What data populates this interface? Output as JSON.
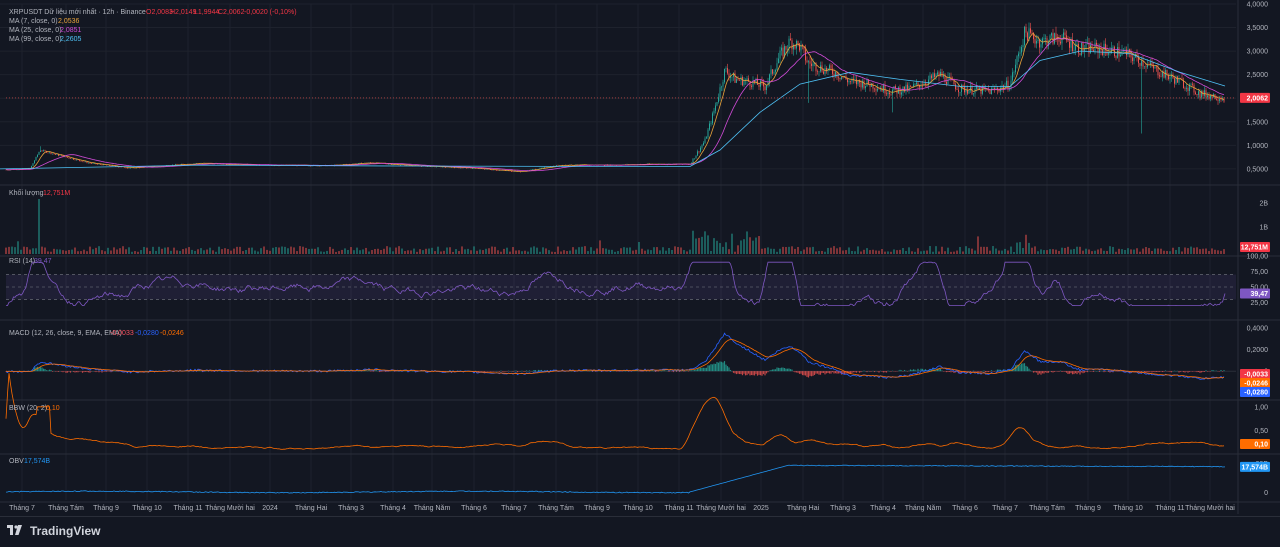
{
  "chart_data": [
    {
      "type": "candlestick",
      "title": "XRPUSDT Dữ liệu mới nhất · 12h · Binance",
      "ohlc": {
        "o": "O2,0083",
        "h": "H2,0149",
        "l": "L1,9944",
        "c": "C2,0062",
        "change": "-0,0020 (-0,10%)"
      },
      "ma": [
        {
          "name": "MA (7, close, 0)",
          "value": "2,0536",
          "color": "#e8a33b"
        },
        {
          "name": "MA (25, close, 0)",
          "value": "2,0851",
          "color": "#d14bd8"
        },
        {
          "name": "MA (99, close, 0)",
          "value": "2,2605",
          "color": "#4fc3f7"
        }
      ],
      "price_ticks": [
        "4,0000",
        "3,5000",
        "3,0000",
        "2,5000",
        "2,0000",
        "1,5000",
        "1,0000",
        "0,5000"
      ],
      "ylim": [
        0.2,
        4.0
      ],
      "last_price": "2,0062",
      "close_series": [
        {
          "x": 0,
          "y": 0.48
        },
        {
          "x": 30,
          "y": 0.5
        },
        {
          "x": 40,
          "y": 0.9
        },
        {
          "x": 60,
          "y": 0.78
        },
        {
          "x": 90,
          "y": 0.62
        },
        {
          "x": 130,
          "y": 0.52
        },
        {
          "x": 200,
          "y": 0.62
        },
        {
          "x": 260,
          "y": 0.58
        },
        {
          "x": 330,
          "y": 0.57
        },
        {
          "x": 370,
          "y": 0.63
        },
        {
          "x": 420,
          "y": 0.56
        },
        {
          "x": 470,
          "y": 0.52
        },
        {
          "x": 520,
          "y": 0.44
        },
        {
          "x": 560,
          "y": 0.58
        },
        {
          "x": 610,
          "y": 0.58
        },
        {
          "x": 650,
          "y": 0.6
        },
        {
          "x": 690,
          "y": 0.6
        },
        {
          "x": 705,
          "y": 1.1
        },
        {
          "x": 715,
          "y": 1.8
        },
        {
          "x": 725,
          "y": 2.6
        },
        {
          "x": 735,
          "y": 2.4
        },
        {
          "x": 750,
          "y": 2.35
        },
        {
          "x": 765,
          "y": 2.25
        },
        {
          "x": 780,
          "y": 2.9
        },
        {
          "x": 790,
          "y": 3.2
        },
        {
          "x": 800,
          "y": 3.1
        },
        {
          "x": 808,
          "y": 2.75
        },
        {
          "x": 820,
          "y": 2.65
        },
        {
          "x": 835,
          "y": 2.55
        },
        {
          "x": 850,
          "y": 2.35
        },
        {
          "x": 870,
          "y": 2.3
        },
        {
          "x": 890,
          "y": 2.15
        },
        {
          "x": 910,
          "y": 2.2
        },
        {
          "x": 940,
          "y": 2.5
        },
        {
          "x": 960,
          "y": 2.2
        },
        {
          "x": 990,
          "y": 2.15
        },
        {
          "x": 1010,
          "y": 2.3
        },
        {
          "x": 1025,
          "y": 3.4
        },
        {
          "x": 1040,
          "y": 3.2
        },
        {
          "x": 1060,
          "y": 3.3
        },
        {
          "x": 1080,
          "y": 3.05
        },
        {
          "x": 1100,
          "y": 3.05
        },
        {
          "x": 1125,
          "y": 2.95
        },
        {
          "x": 1140,
          "y": 2.8
        },
        {
          "x": 1160,
          "y": 2.55
        },
        {
          "x": 1180,
          "y": 2.35
        },
        {
          "x": 1200,
          "y": 2.1
        },
        {
          "x": 1225,
          "y": 2.01
        }
      ],
      "ma99_series": [
        {
          "x": 0,
          "y": 0.5
        },
        {
          "x": 200,
          "y": 0.58
        },
        {
          "x": 400,
          "y": 0.56
        },
        {
          "x": 600,
          "y": 0.55
        },
        {
          "x": 690,
          "y": 0.55
        },
        {
          "x": 720,
          "y": 0.9
        },
        {
          "x": 760,
          "y": 1.7
        },
        {
          "x": 800,
          "y": 2.3
        },
        {
          "x": 850,
          "y": 2.55
        },
        {
          "x": 900,
          "y": 2.4
        },
        {
          "x": 960,
          "y": 2.25
        },
        {
          "x": 1010,
          "y": 2.25
        },
        {
          "x": 1040,
          "y": 2.8
        },
        {
          "x": 1080,
          "y": 3.0
        },
        {
          "x": 1130,
          "y": 2.95
        },
        {
          "x": 1180,
          "y": 2.55
        },
        {
          "x": 1225,
          "y": 2.26
        }
      ]
    },
    {
      "type": "bar",
      "title": "Khối lượng",
      "value": "12,751M",
      "ticks": [
        "2B",
        "1B"
      ],
      "last_value": "12,751M"
    },
    {
      "type": "line",
      "title": "RSI (14)",
      "value": "39,47",
      "ticks": [
        "100,00",
        "75,00",
        "50,00",
        "25,00"
      ],
      "ylim": [
        0,
        100
      ],
      "last_value": "39,47"
    },
    {
      "type": "line",
      "title": "MACD (12, 26, close, 9, EMA, EMA)",
      "values": [
        {
          "value": "-0,0033",
          "color": "#f7525f"
        },
        {
          "value": "-0,0280",
          "color": "#2962ff"
        },
        {
          "value": "-0,0246",
          "color": "#ff6d00"
        }
      ],
      "ticks": [
        "0,4000",
        "0,2000",
        "0"
      ],
      "ylim": [
        -0.25,
        0.42
      ],
      "badges": [
        "-0,0033",
        "-0,0246",
        "-0,0280"
      ]
    },
    {
      "type": "line",
      "title": "BBW (20, 2)",
      "value": "0,10",
      "ticks": [
        "1,00",
        "0,50"
      ],
      "ylim": [
        0.05,
        1.1
      ],
      "last_value": "0,10"
    },
    {
      "type": "line",
      "title": "OBV",
      "value": "17,574B",
      "ticks": [
        "20B",
        "0"
      ],
      "ylim": [
        -5,
        25
      ],
      "last_value": "17,574B"
    }
  ],
  "time_axis": [
    {
      "label": "Tháng 7",
      "x": 22
    },
    {
      "label": "Tháng Tám",
      "x": 66
    },
    {
      "label": "Tháng 9",
      "x": 106
    },
    {
      "label": "Tháng 10",
      "x": 147
    },
    {
      "label": "Tháng 11",
      "x": 188
    },
    {
      "label": "Tháng Mười hai",
      "x": 230
    },
    {
      "label": "2024",
      "x": 270
    },
    {
      "label": "Tháng Hai",
      "x": 311
    },
    {
      "label": "Tháng 3",
      "x": 351
    },
    {
      "label": "Tháng 4",
      "x": 393
    },
    {
      "label": "Tháng Năm",
      "x": 432
    },
    {
      "label": "Tháng 6",
      "x": 474
    },
    {
      "label": "Tháng 7",
      "x": 514
    },
    {
      "label": "Tháng Tám",
      "x": 556
    },
    {
      "label": "Tháng 9",
      "x": 597
    },
    {
      "label": "Tháng 10",
      "x": 638
    },
    {
      "label": "Tháng 11",
      "x": 679
    },
    {
      "label": "Tháng Mười hai",
      "x": 721
    },
    {
      "label": "2025",
      "x": 761
    },
    {
      "label": "Tháng Hai",
      "x": 803
    },
    {
      "label": "Tháng 3",
      "x": 843
    },
    {
      "label": "Tháng 4",
      "x": 883
    },
    {
      "label": "Tháng Năm",
      "x": 923
    },
    {
      "label": "Tháng 6",
      "x": 965
    },
    {
      "label": "Tháng 7",
      "x": 1005
    },
    {
      "label": "Tháng Tám",
      "x": 1047
    },
    {
      "label": "Tháng 9",
      "x": 1088
    },
    {
      "label": "Tháng 10",
      "x": 1128
    },
    {
      "label": "Tháng 11",
      "x": 1170
    },
    {
      "label": "Tháng Mười hai",
      "x": 1210
    }
  ],
  "brand": {
    "name": "TradingView"
  },
  "colors": {
    "up": "#26a69a",
    "down": "#ef5350",
    "background": "#131722",
    "grid": "#1e222d",
    "rsi": "#7e57c2",
    "bbw": "#ff6d00",
    "obv": "#2196f3",
    "last_price_badge": "#f23645"
  }
}
